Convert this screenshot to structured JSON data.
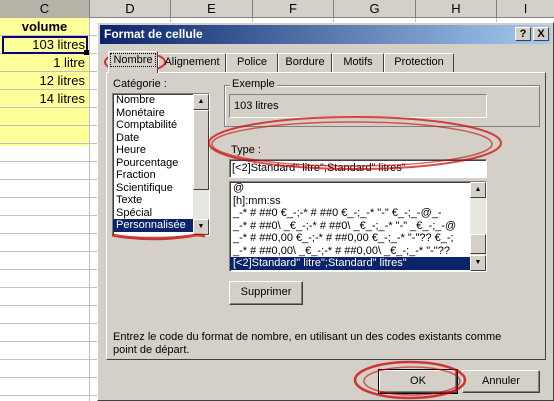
{
  "spreadsheet": {
    "columns": [
      "C",
      "D",
      "E",
      "F",
      "G",
      "H",
      "I"
    ],
    "selected_column": "C",
    "header_cell": "volume",
    "cells": [
      "103 litres",
      "1 litre",
      "12 litres",
      "14 litres"
    ]
  },
  "dialog": {
    "title": "Format de cellule",
    "help_button": "?",
    "close_button": "X",
    "tabs": [
      "Nombre",
      "Alignement",
      "Police",
      "Bordure",
      "Motifs",
      "Protection"
    ],
    "active_tab": "Nombre",
    "category_label": "Catégorie :",
    "categories": [
      "Nombre",
      "Monétaire",
      "Comptabilité",
      "Date",
      "Heure",
      "Pourcentage",
      "Fraction",
      "Scientifique",
      "Texte",
      "Spécial",
      "Personnalisée"
    ],
    "selected_category": "Personnalisée",
    "sample_label": "Exemple",
    "sample_value": "103 litres",
    "type_label": "Type :",
    "type_value": "[<2]Standard\" litre\";Standard\" litres\"",
    "type_list": [
      "@",
      "[h]:mm:ss",
      "_-* # ##0 €_-;-* # ##0 €_-;_-* \"-\" €_-;_-@_-",
      "_-* # ##0\\ _€_-;-* # ##0\\ _€_-;_-* \"-\" _€_-;_-@",
      "_-* # ##0,00 €_-;-* # ##0,00 €_-;_-* \"-\"?? €_-;",
      "_-* # ##0,00\\ _€_-;-* # ##0,00\\ _€_-;_-* \"-\"??",
      "[<2]Standard\" litre\";Standard\" litres\""
    ],
    "selected_type": "[<2]Standard\" litre\";Standard\" litres\"",
    "delete_button": "Supprimer",
    "help_text": "Entrez le code du format de nombre, en utilisant un des codes existants comme point de départ.",
    "ok_button": "OK",
    "cancel_button": "Annuler"
  },
  "colors": {
    "sheet_highlight": "#ffff99",
    "title_gradient_start": "#0a246a",
    "title_gradient_end": "#a6caf0",
    "selection": "#0a246a",
    "annotation": "#cc0000"
  }
}
